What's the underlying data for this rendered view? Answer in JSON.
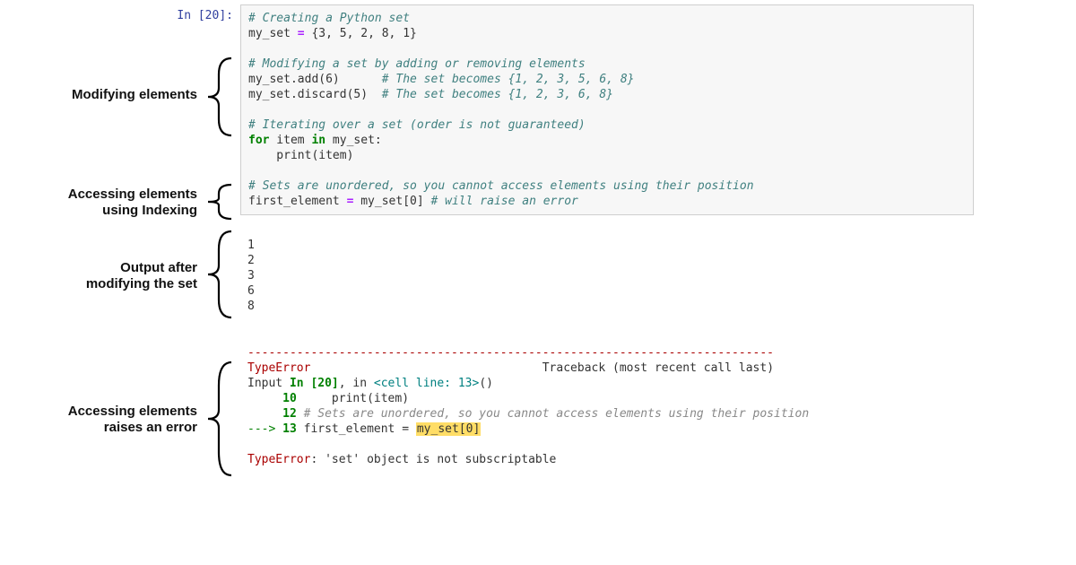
{
  "prompt": "In [20]:",
  "code": {
    "l1_comment": "# Creating a Python set",
    "l2_lhs": "my_set",
    "l2_rhs": " {3, 5, 2, 8, 1}",
    "l4_comment": "# Modifying a set by adding or removing elements",
    "l5": "my_set.add(6)",
    "l5_comment": "# The set becomes {1, 2, 3, 5, 6, 8}",
    "l6": "my_set.discard(5)",
    "l6_comment": "# The set becomes {1, 2, 3, 6, 8}",
    "l8_comment": "# Iterating over a set (order is not guaranteed)",
    "l9_for": "for",
    "l9_item": " item ",
    "l9_in": "in",
    "l9_rest": " my_set:",
    "l10": "    print(item)",
    "l12_comment": "# Sets are unordered, so you cannot access elements using their position",
    "l13_lhs": "first_element",
    "l13_rhs": " my_set[0] ",
    "l13_comment": "# will raise an error"
  },
  "output": {
    "lines": [
      "1",
      "2",
      "3",
      "6",
      "8"
    ]
  },
  "traceback": {
    "sep": "---------------------------------------------------------------------------",
    "errname": "TypeError",
    "traceback_label": "Traceback (most recent call last)",
    "input_label": "Input ",
    "in_cell": "In [20]",
    "in_tail": ", in ",
    "cell_line": "<cell line: 13>",
    "paren": "()",
    "fr10_num": "     10",
    "fr10_body": "     print(item)",
    "fr12_num": "     12",
    "fr12_body": " # Sets are unordered, so you cannot access elements using their position",
    "arrow": "---> ",
    "fr13_num": "13",
    "fr13_body_pre": " first_element = ",
    "fr13_hl": "my_set[0]",
    "final_err": "TypeError",
    "final_msg": ": 'set' object is not subscriptable"
  },
  "annotations": {
    "modifying": "Modifying elements",
    "indexing_line1": "Accessing elements",
    "indexing_line2": "using Indexing",
    "output_line1": "Output after",
    "output_line2": "modifying the set",
    "error_line1": "Accessing elements",
    "error_line2": "raises an error"
  }
}
